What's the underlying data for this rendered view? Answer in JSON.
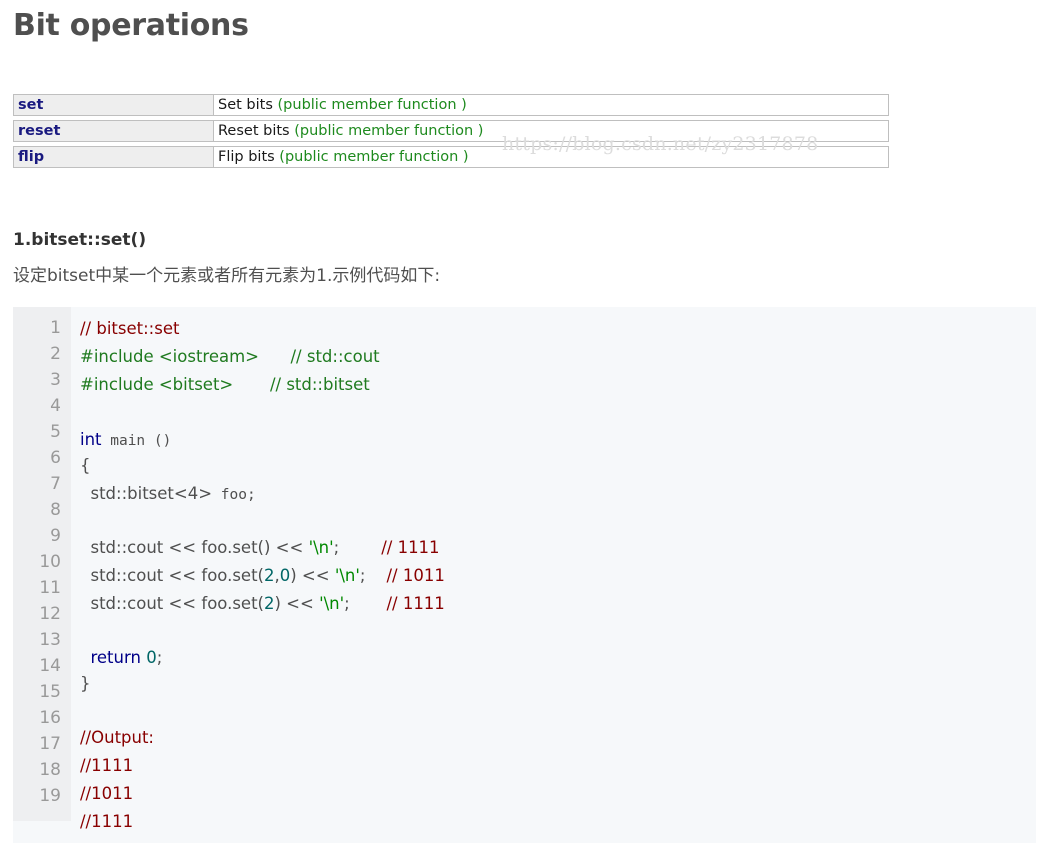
{
  "title": "Bit operations",
  "members": [
    {
      "name": "set",
      "desc": "Set bits",
      "kind": "(public member function )"
    },
    {
      "name": "reset",
      "desc": "Reset bits",
      "kind": "(public member function )"
    },
    {
      "name": "flip",
      "desc": "Flip bits",
      "kind": "(public member function )"
    }
  ],
  "watermark": "https://blog.csdn.net/zy2317878",
  "section": {
    "heading": "1.bitset::set()",
    "desc": "设定bitset中某一个元素或者所有元素为1.示例代码如下:"
  },
  "code": {
    "line_numbers": [
      "1",
      "2",
      "3",
      "4",
      "5",
      "6",
      "7",
      "8",
      "9",
      "10",
      "11",
      "12",
      "13",
      "14",
      "15",
      "16",
      "17",
      "18",
      "19"
    ],
    "l1_comment": "// bitset::set",
    "l2_include": "#include <iostream>",
    "l2_comment": "// std::cout",
    "l3_include": "#include <bitset>",
    "l3_comment": "// std::bitset",
    "l5_kw": "int",
    "l5_main": " main ()",
    "l6": "{",
    "l7_std": "  std::bitset<4>",
    "l7_foo": " foo;",
    "l9_a": "  std::cout << foo.set() << ",
    "l9_str": "'\\n'",
    "l9_semi": ";",
    "l9_comment": "// 1111",
    "l10_a": "  std::cout << foo.set(",
    "l10_n1": "2",
    "l10_b": ",",
    "l10_n2": "0",
    "l10_c": ") << ",
    "l10_str": "'\\n'",
    "l10_semi": ";",
    "l10_comment": "// 1011",
    "l11_a": "  std::cout << foo.set(",
    "l11_n1": "2",
    "l11_c": ") << ",
    "l11_str": "'\\n'",
    "l11_semi": ";",
    "l11_comment": "// 1111",
    "l13_kw": "  return",
    "l13_num": " 0",
    "l13_semi": ";",
    "l14": "}",
    "l16": "//Output:",
    "l17": "//1111",
    "l18": "//1011",
    "l19": "//1111"
  }
}
